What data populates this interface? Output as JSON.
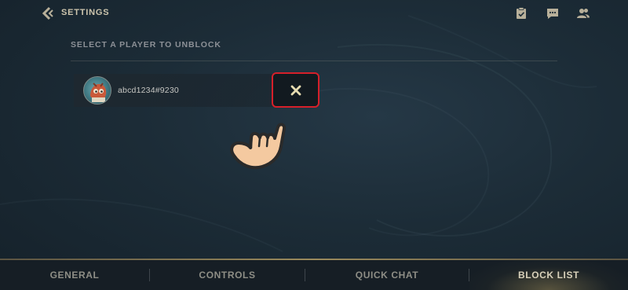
{
  "header": {
    "back_icon": "back-arrow-icon",
    "title": "SETTINGS",
    "icons": [
      "missions-icon",
      "chat-icon",
      "friends-icon"
    ]
  },
  "blocklist": {
    "section_label": "SELECT A PLAYER TO UNBLOCK",
    "players": [
      {
        "name": "abcd1234#9230",
        "avatar": "avatar-icon"
      }
    ],
    "unblock_icon": "close-icon"
  },
  "overlay": {
    "pointer": "pointing-hand-icon"
  },
  "nav": {
    "tabs": [
      {
        "label": "GENERAL",
        "active": false
      },
      {
        "label": "CONTROLS",
        "active": false
      },
      {
        "label": "QUICK CHAT",
        "active": false
      },
      {
        "label": "BLOCK LIST",
        "active": true
      }
    ]
  },
  "colors": {
    "highlight_border": "#d6202a",
    "accent_gold": "#9a8a5c",
    "close_icon": "#e6dcb0"
  }
}
